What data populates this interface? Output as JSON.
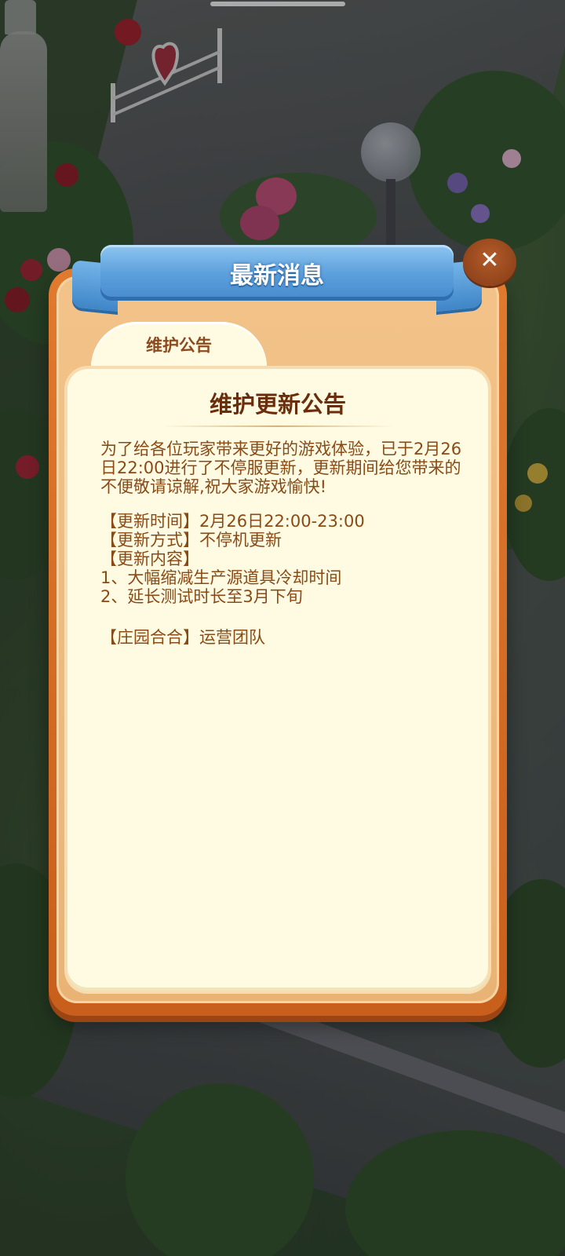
{
  "dialog": {
    "header_title": "最新消息",
    "close_icon": "close-icon",
    "tabs": [
      {
        "label": "维护公告",
        "active": true
      }
    ],
    "content": {
      "title": "维护更新公告",
      "intro": "为了给各位玩家带来更好的游戏体验，已于2月26日22:00进行了不停服更新，更新期间给您带来的不便敬请谅解,祝大家游戏愉快!",
      "lines": [
        "【更新时间】2月26日22:00-23:00",
        "【更新方式】不停机更新",
        "【更新内容】",
        "1、大幅缩减生产源道具冷却时间",
        "2、延长测试时长至3月下旬"
      ],
      "signature": "【庄园合合】运营团队"
    }
  },
  "colors": {
    "header_blue": "#5ca0dc",
    "frame_orange": "#e07a2f",
    "panel_cream": "#fffbe2",
    "text_brown": "#8a4a16",
    "title_brown": "#6b2e0c"
  }
}
